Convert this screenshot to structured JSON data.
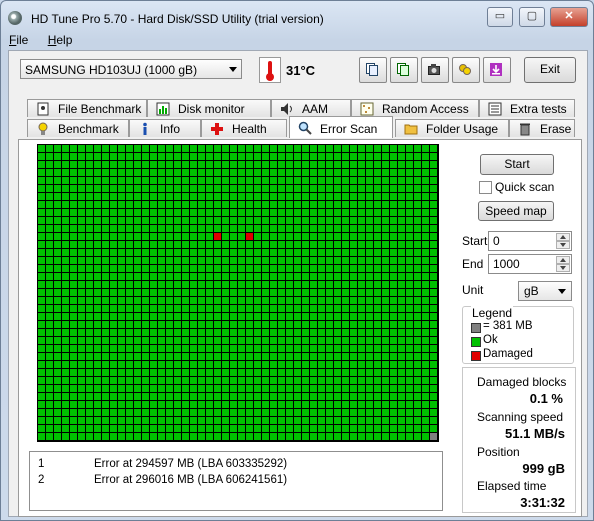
{
  "window": {
    "title": "HD Tune Pro 5.70 - Hard Disk/SSD Utility (trial version)"
  },
  "titlebar_buttons": {
    "minimize": "▭",
    "maximize": "▢",
    "close": "✕"
  },
  "menu": {
    "items": [
      "File",
      "Help"
    ]
  },
  "toolbar": {
    "drive": "SAMSUNG HD103UJ (1000 gB)",
    "temperature": "31°C",
    "icons": [
      "copy-info-icon",
      "copy-all-icon",
      "screenshot-icon",
      "options-icon",
      "save-icon"
    ],
    "exit_label": "Exit"
  },
  "tabs_back": [
    {
      "label": "File Benchmark",
      "icon": "file-benchmark-icon"
    },
    {
      "label": "Disk monitor",
      "icon": "disk-monitor-icon"
    },
    {
      "label": "AAM",
      "icon": "speaker-icon"
    },
    {
      "label": "Random Access",
      "icon": "random-access-icon"
    },
    {
      "label": "Extra tests",
      "icon": "extra-tests-icon"
    }
  ],
  "tabs_front": [
    {
      "label": "Benchmark",
      "icon": "benchmark-icon"
    },
    {
      "label": "Info",
      "icon": "info-icon"
    },
    {
      "label": "Health",
      "icon": "health-cross-icon"
    },
    {
      "label": "Error Scan",
      "icon": "magnifier-icon",
      "active": true
    },
    {
      "label": "Folder Usage",
      "icon": "folder-icon"
    },
    {
      "label": "Erase",
      "icon": "trash-icon"
    }
  ],
  "scan_grid": {
    "columns": 50,
    "rows": 37,
    "damaged_cells": [
      {
        "row": 11,
        "col": 22
      },
      {
        "row": 11,
        "col": 26
      }
    ],
    "unscanned_cells": [
      {
        "row": 36,
        "col": 49
      }
    ],
    "colors": {
      "ok": "#00c000",
      "damaged": "#e00000",
      "unscanned": "#808080",
      "grid": "#000000"
    }
  },
  "errors": [
    {
      "num": "1",
      "text": "Error at 294597 MB (LBA 603335292)"
    },
    {
      "num": "2",
      "text": "Error at 296016 MB (LBA 606241561)"
    }
  ],
  "controls": {
    "start_button": "Start",
    "quick_scan_label": "Quick scan",
    "quick_scan_checked": false,
    "speed_map_button": "Speed map",
    "start_label": "Start",
    "start_value": "0",
    "end_label": "End",
    "end_value": "1000",
    "unit_label": "Unit",
    "unit_value": "gB"
  },
  "legend": {
    "title": "Legend",
    "items": [
      {
        "label": "= 381 MB",
        "color": "#808080"
      },
      {
        "label": "Ok",
        "color": "#00c000"
      },
      {
        "label": "Damaged",
        "color": "#e00000"
      }
    ]
  },
  "stats": {
    "damaged_blocks_label": "Damaged blocks",
    "damaged_blocks_value": "0.1 %",
    "scanning_speed_label": "Scanning speed",
    "scanning_speed_value": "51.1 MB/s",
    "position_label": "Position",
    "position_value": "999 gB",
    "elapsed_label": "Elapsed time",
    "elapsed_value": "3:31:32"
  }
}
